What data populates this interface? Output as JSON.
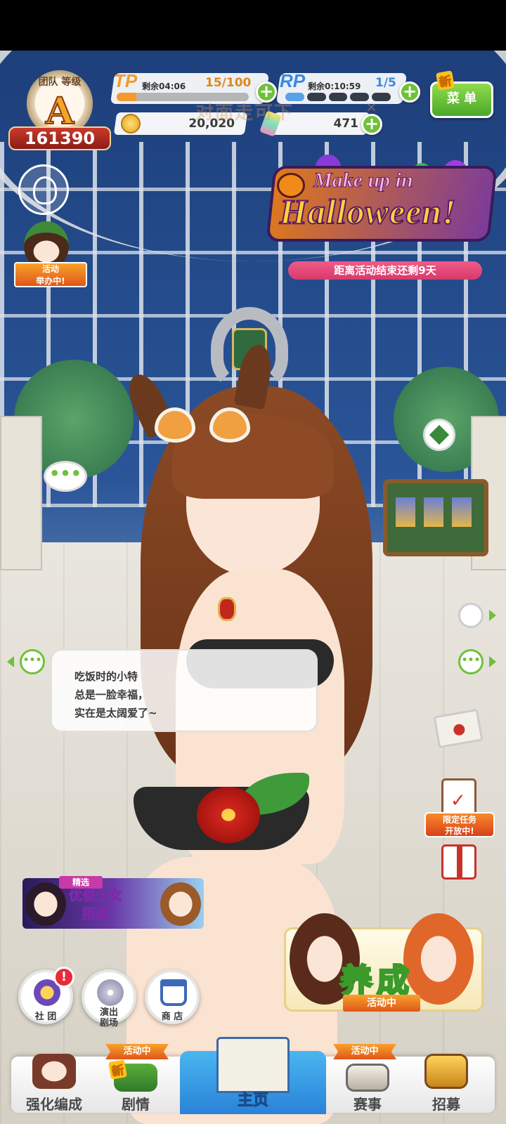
{
  "team_rank": {
    "label": "团队 等级",
    "grade": "A",
    "score": "161390"
  },
  "resources": {
    "tp": {
      "label": "TP",
      "timer": "剩余04:06",
      "count": "15/100",
      "fill_fraction": 0.15
    },
    "rp": {
      "label": "RP",
      "timer": "剩余0:10:59",
      "count": "1/5",
      "filled_pips": 1,
      "total_pips": 5
    },
    "coins": "20,020",
    "jewels": "471"
  },
  "menu": {
    "label": "菜 单",
    "new_tag": "新"
  },
  "watermark": "对面走可下",
  "left_panel": {
    "event_label": "活动\n举办中!"
  },
  "event_banner": {
    "line1": "Make up in",
    "line2": "Halloween!",
    "countdown": "距离活动结束还剩9天"
  },
  "chat_bubble": "•••",
  "speech": {
    "lines": [
      "吃饭时的小特",
      "总是一脸幸福，",
      "实在是太阔爱了~"
    ]
  },
  "right_panel": {
    "limited_mission": "限定任务\n开放中!"
  },
  "gacha": {
    "tag": "精选",
    "title": "优俊少女\n招募"
  },
  "round_buttons": {
    "club": "社 团",
    "club_badge": "!",
    "theater": "演出\n剧场",
    "shop": "商 店"
  },
  "training": {
    "title": "养成",
    "status": "活动中"
  },
  "bottom_nav": {
    "enhance": "强化编成",
    "story": "剧情",
    "story_tag": "活动中",
    "story_new": "新",
    "home": "主页",
    "race": "赛事",
    "race_tag": "活动中",
    "gacha": "招募"
  },
  "colors": {
    "accent_green": "#6fc13a",
    "event_orange": "#e0561a",
    "countdown_pink": "#d83a6a",
    "tp_orange": "#f49a2a",
    "rp_blue": "#5aa2e6"
  }
}
